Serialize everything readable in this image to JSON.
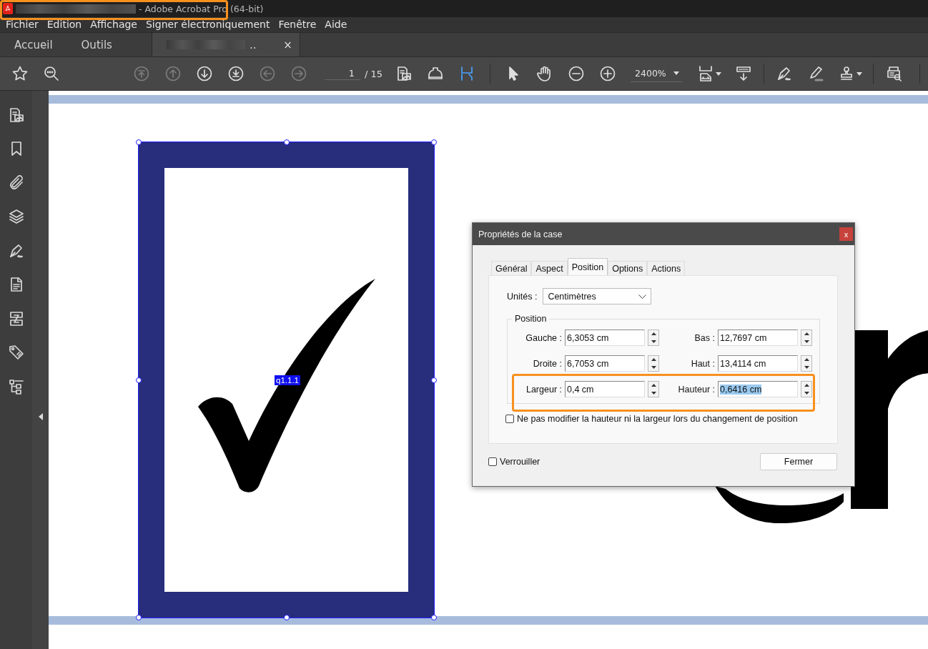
{
  "window": {
    "title": "- Adobe Acrobat Pro (64-bit)",
    "filename_redacted": true
  },
  "menu": [
    "Fichier",
    "Edition",
    "Affichage",
    "Signer électroniquement",
    "Fenêtre",
    "Aide"
  ],
  "tabs": [
    {
      "label": "Accueil",
      "selected": false
    },
    {
      "label": "Outils",
      "selected": false
    },
    {
      "label": "..",
      "selected": true,
      "redacted": true,
      "close": "×"
    }
  ],
  "toolbar": {
    "left": [
      {
        "kind": "star",
        "disabled": false
      },
      {
        "kind": "search",
        "disabled": false
      }
    ],
    "nav": [
      {
        "kind": "first",
        "disabled": true
      },
      {
        "kind": "up",
        "disabled": true
      },
      {
        "kind": "down",
        "disabled": false
      },
      {
        "kind": "last",
        "disabled": false
      },
      {
        "kind": "back",
        "disabled": true
      },
      {
        "kind": "forward",
        "disabled": true
      }
    ],
    "page": "1",
    "page_total": "/ 15",
    "mid": [
      {
        "kind": "pages",
        "selected": false
      },
      {
        "kind": "ink",
        "selected": false
      },
      {
        "kind": "measure",
        "selected": true
      }
    ],
    "tools": [
      {
        "kind": "pointer"
      },
      {
        "kind": "hand"
      },
      {
        "kind": "minus"
      },
      {
        "kind": "plus"
      }
    ],
    "zoom": "2400%",
    "right": [
      {
        "kind": "fit"
      },
      {
        "kind": "scroll"
      },
      {
        "kind": "sep"
      },
      {
        "kind": "sign"
      },
      {
        "kind": "highlight"
      },
      {
        "kind": "stamp"
      },
      {
        "kind": "sep"
      },
      {
        "kind": "preview"
      }
    ]
  },
  "sidebar": [
    {
      "kind": "pages"
    },
    {
      "kind": "bookmark"
    },
    {
      "kind": "attach"
    },
    {
      "kind": "layers"
    },
    {
      "kind": "sign"
    },
    {
      "kind": "doc"
    },
    {
      "kind": "order"
    },
    {
      "kind": "tag"
    },
    {
      "kind": "tree"
    }
  ],
  "canvas": {
    "field_label": "q1.1.1"
  },
  "dialog": {
    "title": "Propriétés de la case",
    "close": "x",
    "tabs": [
      {
        "label": "Général",
        "selected": false
      },
      {
        "label": "Aspect",
        "selected": false
      },
      {
        "label": "Position",
        "selected": true
      },
      {
        "label": "Options",
        "selected": false
      },
      {
        "label": "Actions",
        "selected": false
      }
    ],
    "units_label": "Unités :",
    "units": "Centimètres",
    "group": "Position",
    "fields": [
      {
        "label": "Gauche :",
        "value": "6,3053 cm",
        "text_selected": false
      },
      {
        "label": "Bas :",
        "value": "12,7697 cm",
        "text_selected": false
      },
      {
        "label": "Droite :",
        "value": "6,7053 cm",
        "text_selected": false
      },
      {
        "label": "Haut :",
        "value": "13,4114 cm",
        "text_selected": false
      },
      {
        "label": "Largeur :",
        "value": "0,4 cm",
        "text_selected": false
      },
      {
        "label": "Hauteur :",
        "value": "0,6416 cm",
        "text_selected": true
      }
    ],
    "keep_size": {
      "label": "Ne pas modifier la hauteur ni la largeur lors du changement de position",
      "checked": false
    },
    "lock": {
      "label": "Verrouiller",
      "checked": false
    },
    "button": "Fermer"
  }
}
